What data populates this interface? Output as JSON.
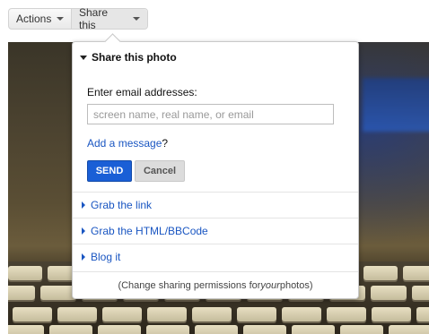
{
  "toolbar": {
    "actions_label": "Actions",
    "share_label": "Share this"
  },
  "share_popup": {
    "title": "Share this photo",
    "email_label": "Enter email addresses:",
    "email_placeholder": "screen name, real name, or email",
    "email_value": "",
    "add_message_link": "Add a message",
    "add_message_suffix": "?",
    "send_label": "SEND",
    "cancel_label": "Cancel",
    "options": [
      {
        "label": "Grab the link"
      },
      {
        "label": "Grab the HTML/BBCode"
      },
      {
        "label": "Blog it"
      }
    ],
    "footer": {
      "prefix": "(Change sharing permissions for ",
      "emphasis": "your",
      "suffix": " photos)"
    }
  },
  "colors": {
    "link": "#1a56c2",
    "send_button": "#1a5fd6",
    "cancel_button": "#dcdcdc"
  },
  "icons": {
    "menu_caret": "chevron-down-icon",
    "collapse_triangle": "triangle-down-icon",
    "expand_triangle": "triangle-right-icon"
  }
}
